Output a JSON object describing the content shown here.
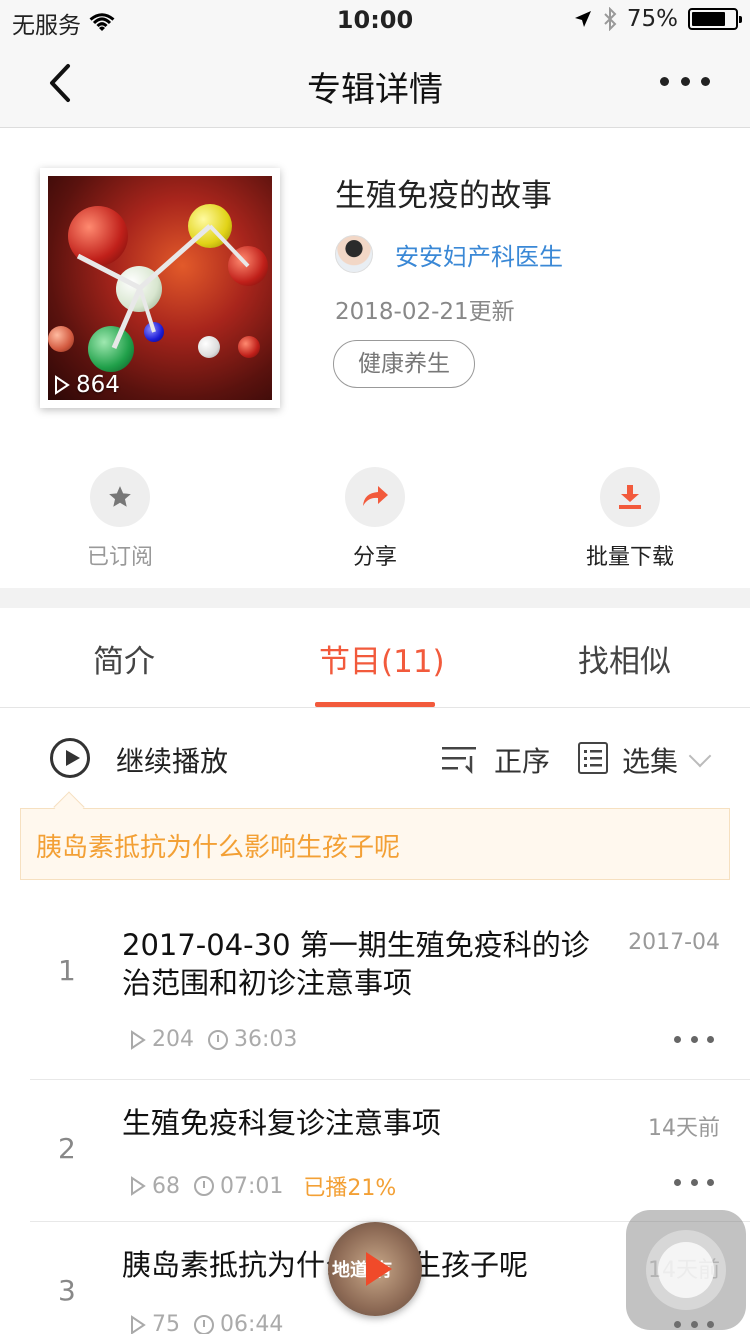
{
  "status_bar": {
    "carrier": "无服务",
    "time": "10:00",
    "battery": "75%"
  },
  "nav": {
    "title": "专辑详情"
  },
  "album": {
    "title": "生殖免疫的故事",
    "author": "安安妇产科医生",
    "updated": "2018-02-21更新",
    "tag": "健康养生",
    "play_count": "864"
  },
  "actions": {
    "subscribe": "已订阅",
    "share": "分享",
    "download": "批量下载"
  },
  "tabs": {
    "intro": "简介",
    "episodes": "节目(11)",
    "similar": "找相似"
  },
  "toolbar": {
    "continue": "继续播放",
    "sort": "正序",
    "select": "选集"
  },
  "hint": "胰岛素抵抗为什么影响生孩子呢",
  "episodes": [
    {
      "index": "1",
      "title": "2017-04-30 第一期生殖免疫科的诊治范围和初诊注意事项",
      "date": "2017-04",
      "plays": "204",
      "duration": "36:03",
      "progress": ""
    },
    {
      "index": "2",
      "title": "生殖免疫科复诊注意事项",
      "date": "14天前",
      "plays": "68",
      "duration": "07:01",
      "progress": "已播21%"
    },
    {
      "index": "3",
      "title": "胰岛素抵抗为什么影响生孩子呢",
      "date": "14天前",
      "plays": "75",
      "duration": "06:44",
      "progress": ""
    }
  ],
  "player": {
    "label": "地道 有"
  },
  "colors": {
    "accent": "#f25a3c",
    "link": "#3a88d6",
    "highlight": "#f3a035"
  }
}
